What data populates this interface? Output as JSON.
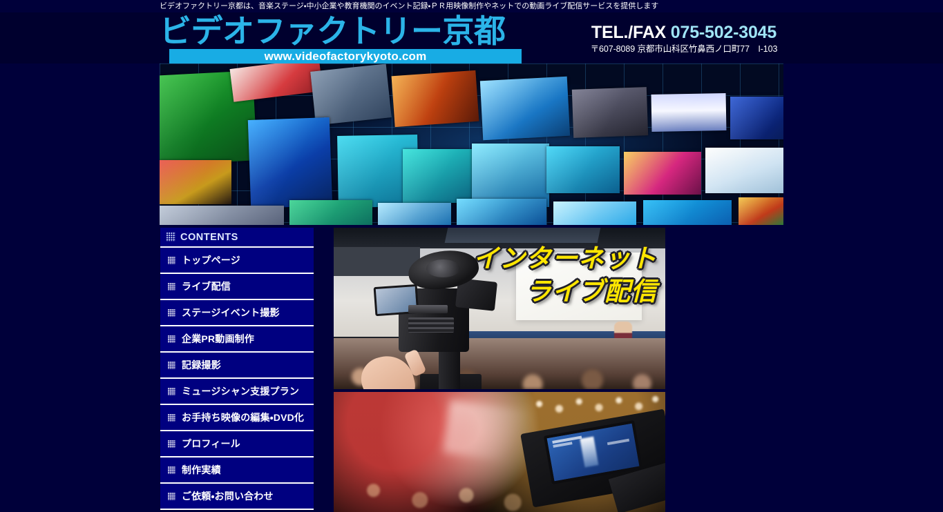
{
  "header": {
    "tagline": "ビデオファクトリー京都は、音楽ステージ・中小企業や教育機関のイベント記録・ＰＲ用映像制作やネットでの動画ライブ配信サービスを提供します",
    "logo_title": "ビデオファクトリー京都",
    "logo_url": "www.videofactorykyoto.com",
    "tel_label": "TEL./FAX ",
    "tel_number": "075-502-3045",
    "address": "〒607-8089 京都市山科区竹鼻西ノ口町77　I-103",
    "colors": {
      "page_bg": "#00003a",
      "logo_cyan": "#2bb4e8",
      "url_bar": "#18ace4",
      "tel_number": "#9fe4f5",
      "sidebar_bg": "#000080",
      "overlay_yellow": "#ffe600"
    }
  },
  "banner": {
    "alt": "映像モニターのコラージュバナー"
  },
  "sidebar": {
    "heading": "CONTENTS",
    "heading_icon": "dotted-square-icon",
    "items": [
      {
        "label": "トップページ",
        "icon": "dotted-square-icon"
      },
      {
        "label": "ライブ配信",
        "icon": "dotted-square-icon"
      },
      {
        "label": "ステージイベント撮影",
        "icon": "dotted-square-icon"
      },
      {
        "label": "企業PR動画制作",
        "icon": "dotted-square-icon"
      },
      {
        "label": "記録撮影",
        "icon": "dotted-square-icon"
      },
      {
        "label": "ミュージシャン支援プラン",
        "icon": "dotted-square-icon"
      },
      {
        "label": "お手持ち映像の編集・DVD化",
        "icon": "dotted-square-icon"
      },
      {
        "label": "プロフィール",
        "icon": "dotted-square-icon"
      },
      {
        "label": "制作実績",
        "icon": "dotted-square-icon"
      },
      {
        "label": "ご依頼・お問い合わせ",
        "icon": "dotted-square-icon"
      }
    ]
  },
  "main": {
    "hero_overlay_line1": "インターネット",
    "hero_overlay_line2": "ライブ配信",
    "hero_alt": "セミナー会場を撮影する業務用ビデオカメラ",
    "second_photo_alt": "ステージ照明とビデオカメラの液晶モニター"
  }
}
